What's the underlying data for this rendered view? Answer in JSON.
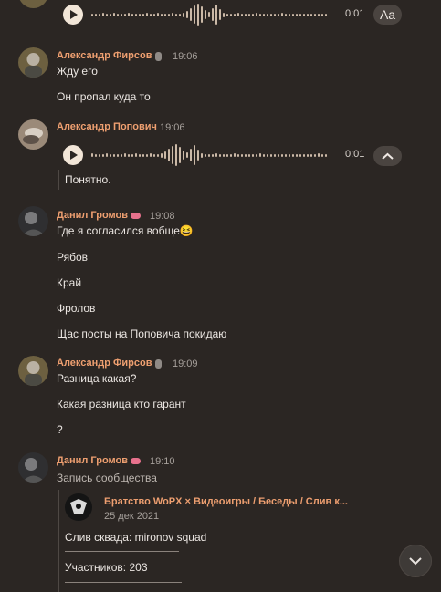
{
  "top_voice": {
    "duration": "0:01",
    "aa_label": "Aa"
  },
  "messages": [
    {
      "author": "Александр Фирсов",
      "time": "19:06",
      "lines": [
        "Жду его",
        "Он пропал куда то"
      ]
    },
    {
      "author": "Александр Попович",
      "time": "19:06",
      "voice_duration": "0:01",
      "quote": "Понятно."
    },
    {
      "author": "Данил Громов",
      "time": "19:08",
      "lines": [
        "Где я согласился вобще😆",
        "Рябов",
        "Край",
        "Фролов",
        "Щас посты на Поповича покидаю"
      ]
    },
    {
      "author": "Александр Фирсов",
      "time": "19:09",
      "lines": [
        "Разница какая?",
        "Какая разница кто гарант",
        "?"
      ]
    },
    {
      "author": "Данил Громов",
      "time": "19:10",
      "subtitle": "Запись сообщества",
      "post": {
        "source": "Братство WoPX × Видеоигры / Беседы / Слив к...",
        "date": "25 дек 2021",
        "line1": "Слив сквада: mironov squad",
        "line2": "Участников: 203"
      }
    }
  ]
}
